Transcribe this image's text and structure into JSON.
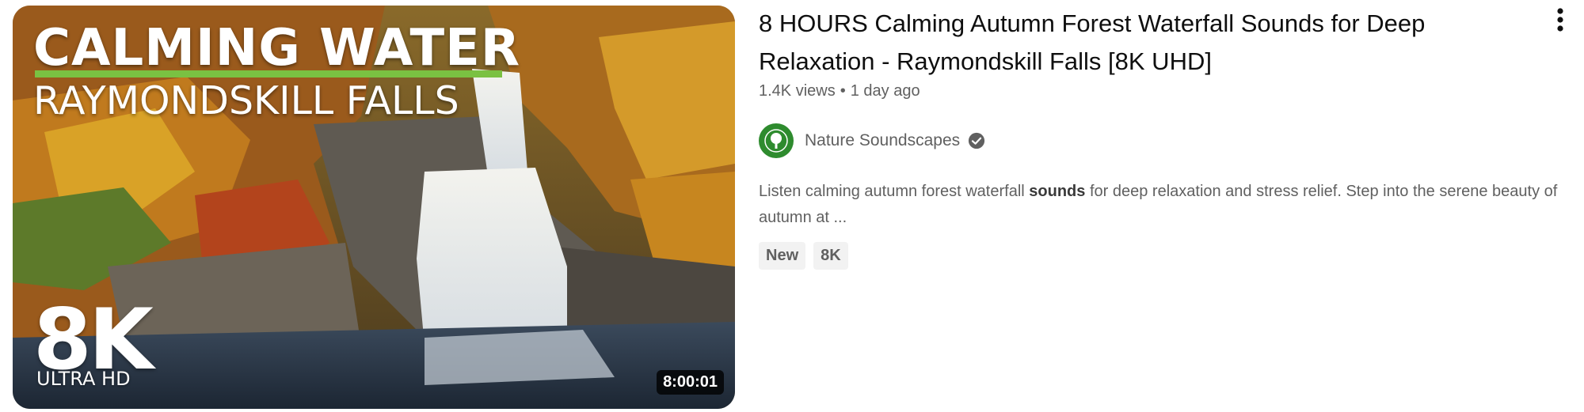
{
  "video": {
    "title": "8 HOURS Calming Autumn Forest Waterfall Sounds for Deep Relaxation - Raymondskill Falls [8K UHD]",
    "views": "1.4K views",
    "separator": "•",
    "age": "1 day ago",
    "duration": "8:00:01",
    "description_before": "Listen calming autumn forest waterfall ",
    "description_bold": "sounds",
    "description_after": " for deep relaxation and stress relief. Step into the serene beauty of autumn at ...",
    "badges": [
      "New",
      "8K"
    ]
  },
  "thumbnail": {
    "headline": "CALMING WATER",
    "subheadline": "RAYMONDSKILL FALLS",
    "resolution_badge": "8K",
    "resolution_caption": "ULTRA HD",
    "accent_color": "#7ac142"
  },
  "channel": {
    "name": "Nature Soundscapes",
    "verified": true,
    "avatar_icon": "tree-icon",
    "verified_icon": "check-circle-icon"
  },
  "menu": {
    "icon": "more-vert-icon"
  }
}
